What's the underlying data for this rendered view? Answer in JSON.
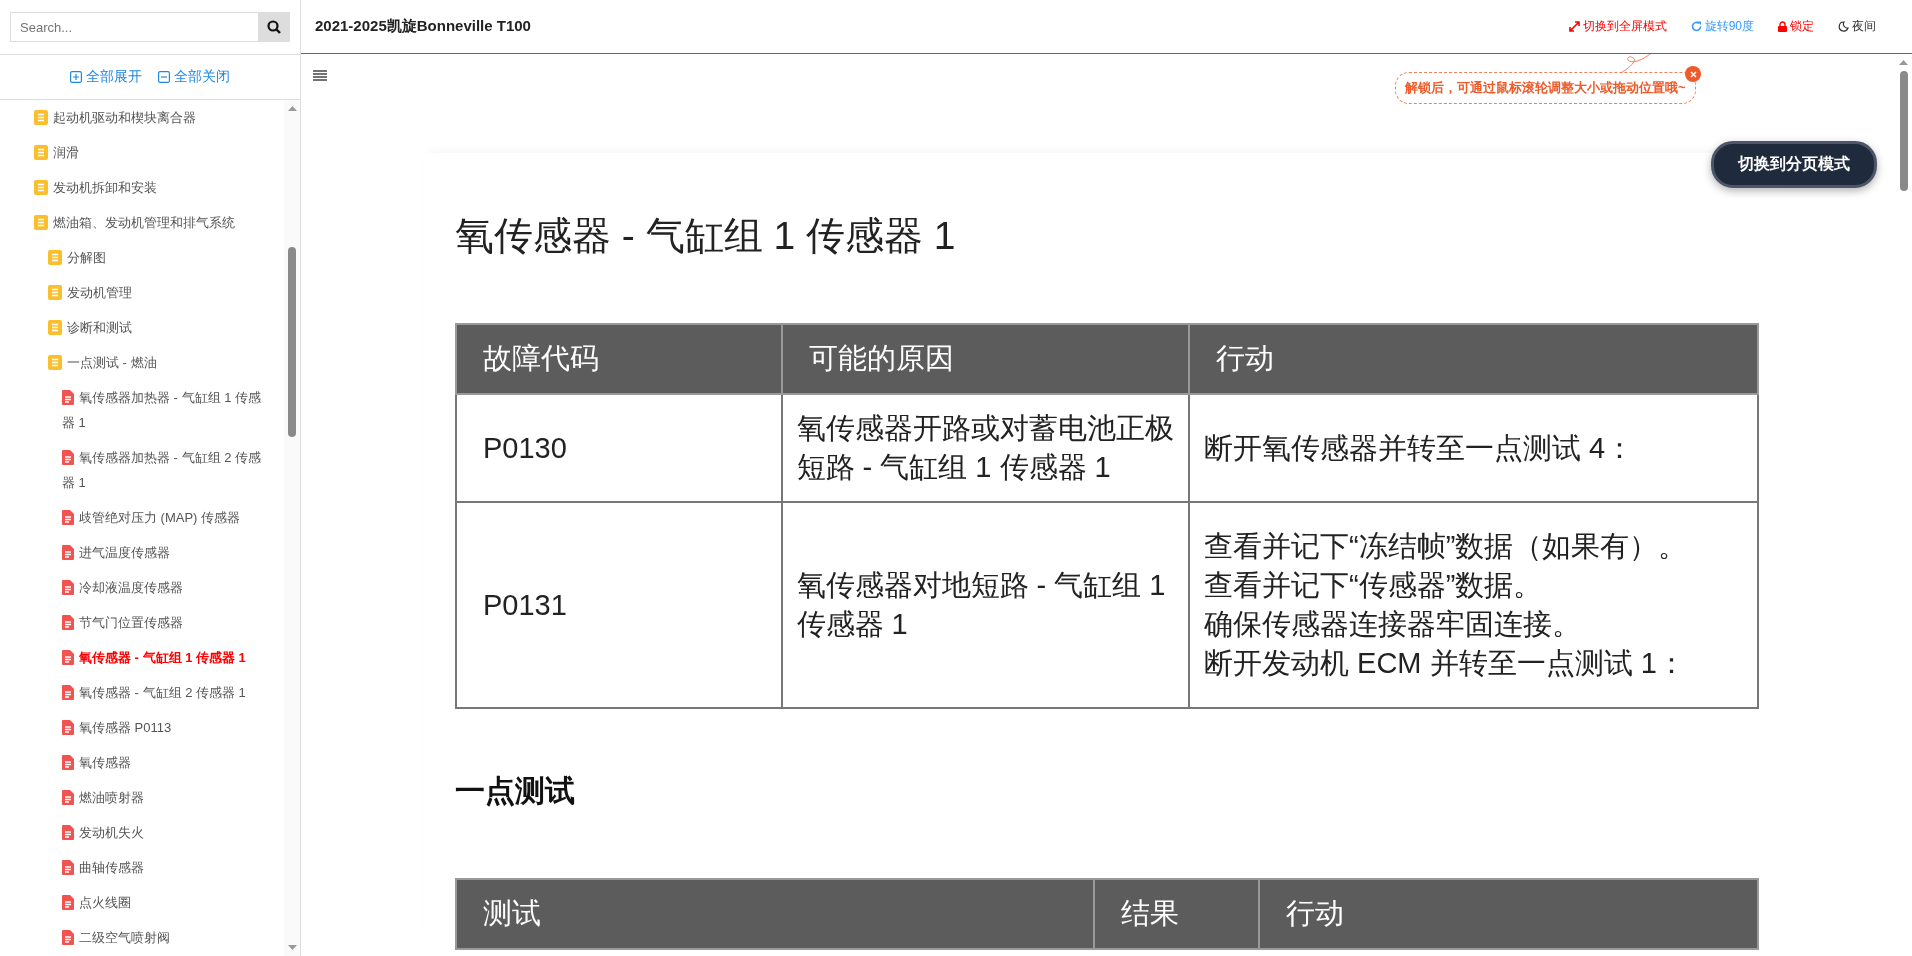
{
  "sidebar": {
    "search": {
      "placeholder": "Search..."
    },
    "tree_actions": [
      {
        "kind": "expand",
        "label": "全部展开"
      },
      {
        "kind": "collapse",
        "label": "全部关闭"
      }
    ],
    "tree": [
      {
        "label": "起动机驱动和楔块离合器",
        "kind": "folder",
        "selected": false
      },
      {
        "label": "润滑",
        "kind": "folder",
        "selected": false
      },
      {
        "label": "发动机拆卸和安装",
        "kind": "folder",
        "selected": false
      },
      {
        "label": "燃油箱、发动机管理和排气系统",
        "kind": "folder",
        "selected": false,
        "children": [
          {
            "label": "分解图",
            "kind": "folder",
            "selected": false
          },
          {
            "label": "发动机管理",
            "kind": "folder",
            "selected": false
          },
          {
            "label": "诊断和测试",
            "kind": "folder",
            "selected": false
          },
          {
            "label": "一点测试 - 燃油",
            "kind": "folder",
            "selected": false,
            "children": [
              {
                "label": "氧传感器加热器 - 气缸组 1 传感器 1",
                "kind": "page",
                "selected": false
              },
              {
                "label": "氧传感器加热器 - 气缸组 2 传感器 1",
                "kind": "page",
                "selected": false
              },
              {
                "label": "歧管绝对压力 (MAP) 传感器",
                "kind": "page",
                "selected": false
              },
              {
                "label": "进气温度传感器",
                "kind": "page",
                "selected": false
              },
              {
                "label": "冷却液温度传感器",
                "kind": "page",
                "selected": false
              },
              {
                "label": "节气门位置传感器",
                "kind": "page",
                "selected": false
              },
              {
                "label": "氧传感器 - 气缸组 1 传感器 1",
                "kind": "page",
                "selected": true
              },
              {
                "label": "氧传感器 - 气缸组 2 传感器 1",
                "kind": "page",
                "selected": false
              },
              {
                "label": "氧传感器 P0113",
                "kind": "page",
                "selected": false
              },
              {
                "label": "氧传感器",
                "kind": "page",
                "selected": false
              },
              {
                "label": "燃油喷射器",
                "kind": "page",
                "selected": false
              },
              {
                "label": "发动机失火",
                "kind": "page",
                "selected": false
              },
              {
                "label": "曲轴传感器",
                "kind": "page",
                "selected": false
              },
              {
                "label": "点火线圈",
                "kind": "page",
                "selected": false
              },
              {
                "label": "二级空气喷射阀",
                "kind": "page",
                "selected": false
              }
            ]
          }
        ]
      }
    ]
  },
  "header": {
    "title": "2021-2025凯旋Bonneville T100",
    "actions": [
      {
        "kind": "fullscreen",
        "label": "切换到全屏模式",
        "color": "#ff0000"
      },
      {
        "kind": "rotate",
        "label": "旋转90度",
        "color": "#3399ff"
      },
      {
        "kind": "lock",
        "label": "锁定",
        "color": "#ff0000"
      },
      {
        "kind": "night",
        "label": "夜间",
        "color": "#333333"
      }
    ]
  },
  "tooltip": {
    "text": "解锁后，可通过鼠标滚轮调整大小或拖动位置哦~"
  },
  "page_mode_button": "切换到分页模式",
  "document": {
    "title": "氧传感器 - 气缸组 1 传感器 1",
    "fault_table": {
      "columns": [
        "故障代码",
        "可能的原因",
        "行动"
      ],
      "rows": [
        [
          "P0130",
          "氧传感器开路或对蓄电池正极短路 - 气缸组 1 传感器 1",
          "断开氧传感器并转至一点测试 4："
        ],
        [
          "P0131",
          "氧传感器对地短路 - 气缸组 1 传感器 1",
          [
            "查看并记下“冻结帧”数据（如果有）。",
            "查看并记下“传感器”数据。",
            "确保传感器连接器牢固连接。",
            "断开发动机 ECM 并转至一点测试 1："
          ]
        ]
      ]
    },
    "section_title": "一点测试",
    "test_table": {
      "columns": [
        "测试",
        "结果",
        "行动"
      ]
    }
  }
}
